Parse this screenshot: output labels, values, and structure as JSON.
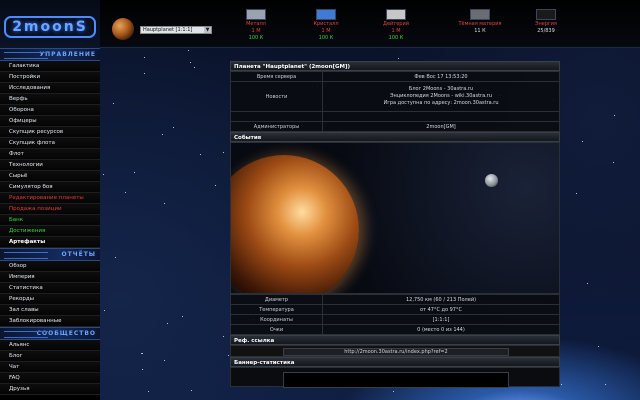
{
  "logo": "2moonS",
  "planet_select": "Hauptplanet [1:1:1]",
  "resources": [
    {
      "name": "Металл",
      "prod": "1 М",
      "stock": "100 К",
      "color": "#9aa3ad",
      "icon": "metal-icon"
    },
    {
      "name": "Кристалл",
      "prod": "1 М",
      "stock": "100 К",
      "color": "#3f7ad6",
      "icon": "crystal-icon"
    },
    {
      "name": "Дейтерий",
      "prod": "1 М",
      "stock": "100 К",
      "color": "#c7c7c7",
      "icon": "deuterium-icon"
    },
    {
      "name": "Тёмная материя",
      "prod": "",
      "stock": "11 К",
      "color": "#6b6d73",
      "icon": "dark-matter-icon"
    },
    {
      "name": "Энергия",
      "prod": "",
      "stock": "25/839",
      "color": "#1a1a1a",
      "icon": "energy-icon"
    }
  ],
  "sidebar": {
    "management_title": "УПРАВЛЕНИЕ",
    "management": [
      {
        "label": "Галактика",
        "style": ""
      },
      {
        "label": "Постройки",
        "style": ""
      },
      {
        "label": "Исследования",
        "style": ""
      },
      {
        "label": "Верфь",
        "style": ""
      },
      {
        "label": "Оборона",
        "style": ""
      },
      {
        "label": "Офицеры",
        "style": ""
      },
      {
        "label": "Скупщик ресурсов",
        "style": ""
      },
      {
        "label": "Скупщик флота",
        "style": ""
      },
      {
        "label": "Флот",
        "style": ""
      },
      {
        "label": "Технологии",
        "style": ""
      },
      {
        "label": "Сырьё",
        "style": ""
      },
      {
        "label": "Симулятор боя",
        "style": ""
      },
      {
        "label": "Редактирование планеты",
        "style": "red"
      },
      {
        "label": "Продажа позиции",
        "style": "red"
      },
      {
        "label": "Банк",
        "style": "green"
      },
      {
        "label": "Достижения",
        "style": "green"
      },
      {
        "label": "Артефакты",
        "style": "white-bold"
      }
    ],
    "reports_title": "ОТЧЁТЫ",
    "reports": [
      {
        "label": "Обзор"
      },
      {
        "label": "Империя"
      },
      {
        "label": "Статистика"
      },
      {
        "label": "Рекорды"
      },
      {
        "label": "Зал славы"
      },
      {
        "label": "Заблокированные"
      }
    ],
    "community_title": "СООБЩЕСТВО",
    "community": [
      {
        "label": "Альянс"
      },
      {
        "label": "Блог"
      },
      {
        "label": "Чат"
      },
      {
        "label": "FAQ"
      },
      {
        "label": "Друзья"
      }
    ]
  },
  "main": {
    "planet_title": "Планета \"Hauptplanet\" (2moon[GM])",
    "server_time_label": "Время сервера",
    "server_time_value": "Фев Вос 17 13:53:20",
    "news_label": "Новости",
    "news_lines": [
      "Блог 2Moons - 30astra.ru",
      "Энциклопедия 2Moons - wiki.30astra.ru",
      "Игра доступна по адресу: 2moon.30astra.ru"
    ],
    "admins_label": "Администраторы",
    "admins_value": "2moon[GM]",
    "events_title": "События",
    "diameter_label": "Диаметр",
    "diameter_value": "12,750 км (60 / 213 Полей)",
    "temperature_label": "Температура",
    "temperature_value": "от 47°C до 97°C",
    "coords_label": "Координаты",
    "coords_value": "[1:1:1]",
    "points_label": "Очки",
    "points_value": "0 (место 0 из 144)",
    "ref_title": "Реф. ссылка",
    "ref_url": "http://2moon.30astra.ru/index.php?ref=2",
    "banner_title": "Баннер-статистика"
  }
}
